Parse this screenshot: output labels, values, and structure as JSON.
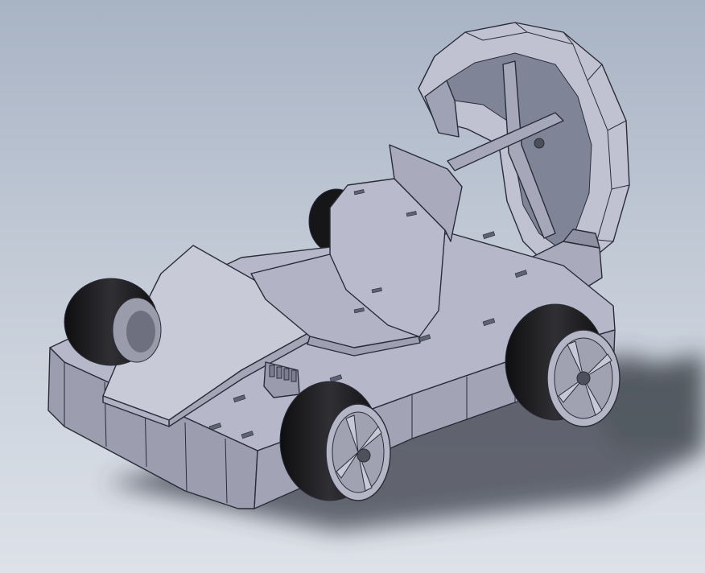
{
  "scene": {
    "palette": {
      "background_top": "#a8b3c4",
      "background_bottom": "#dde2e9",
      "part_light": "#c4c6d6",
      "part_mid": "#aaacbe",
      "part_dark": "#8e90a2",
      "tire": "#1c1c1e",
      "edge_line": "#2a2c38",
      "shadow": "#3a3e48"
    },
    "objects": [
      "kart-chassis",
      "front-body-panel",
      "seat",
      "hamster-wheel",
      "front-left-wheel",
      "front-right-wheel",
      "rear-left-wheel",
      "rear-right-wheel",
      "steering-rack"
    ]
  }
}
